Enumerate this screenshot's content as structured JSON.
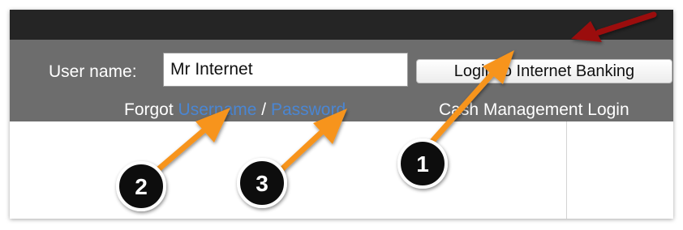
{
  "login": {
    "username_label": "User name:",
    "username_value": "Mr Internet",
    "login_button": "Login to Internet Banking",
    "forgot_prefix": "Forgot",
    "forgot_username_link": "Username",
    "separator": "/",
    "forgot_password_link": "Password",
    "cash_management_link": "Cash Management Login"
  },
  "annotations": {
    "markers": [
      {
        "number": "1"
      },
      {
        "number": "2"
      },
      {
        "number": "3"
      }
    ],
    "arrow_color": "#f7941d",
    "marker_color": "#111111",
    "red_arrow_color": "#9b0f0f"
  },
  "colors": {
    "topbar": "#252525",
    "loginbar": "#6d6d6d",
    "link": "#4a86d3"
  }
}
